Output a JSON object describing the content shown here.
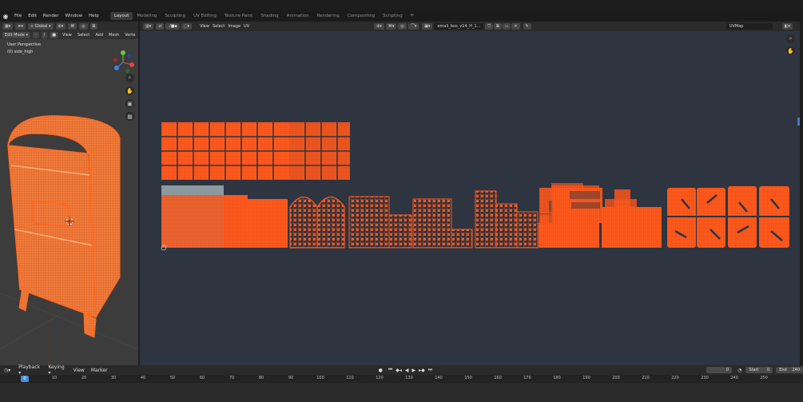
{
  "topbar": {
    "menus": [
      "File",
      "Edit",
      "Render",
      "Window",
      "Help"
    ],
    "workspaces": [
      "Layout",
      "Modeling",
      "Sculpting",
      "UV Editing",
      "Texture Paint",
      "Shading",
      "Animation",
      "Rendering",
      "Compositing",
      "Scripting"
    ],
    "active_workspace": "Layout"
  },
  "viewport3d": {
    "transform_orientation": "Global",
    "mode": "Edit Mode",
    "menus": [
      "View",
      "Select",
      "Add",
      "Mesh",
      "Verte"
    ],
    "perspective_label": "User Perspective",
    "object_label": "(0) side_high"
  },
  "uv_editor": {
    "menus": [
      "View",
      "Select",
      "Image",
      "UV"
    ],
    "image_name": "email_box_v14_H_1...",
    "uvmap_name": "UVMap"
  },
  "timeline": {
    "menus": [
      "Playback",
      "Keying",
      "View",
      "Marker"
    ],
    "current_frame": "0",
    "start_label": "Start",
    "start_value": "0",
    "end_label": "End",
    "end_value": "240",
    "playhead_frame": "0",
    "ticks": [
      "10",
      "20",
      "30",
      "40",
      "50",
      "60",
      "70",
      "80",
      "90",
      "100",
      "110",
      "120",
      "130",
      "140",
      "150",
      "160",
      "170",
      "180",
      "190",
      "200",
      "210",
      "220",
      "230",
      "240",
      "250"
    ]
  },
  "colors": {
    "uv_orange": "#ff5a1e",
    "selection_blue": "#4a8fdc",
    "uv_background": "#2e3440"
  }
}
